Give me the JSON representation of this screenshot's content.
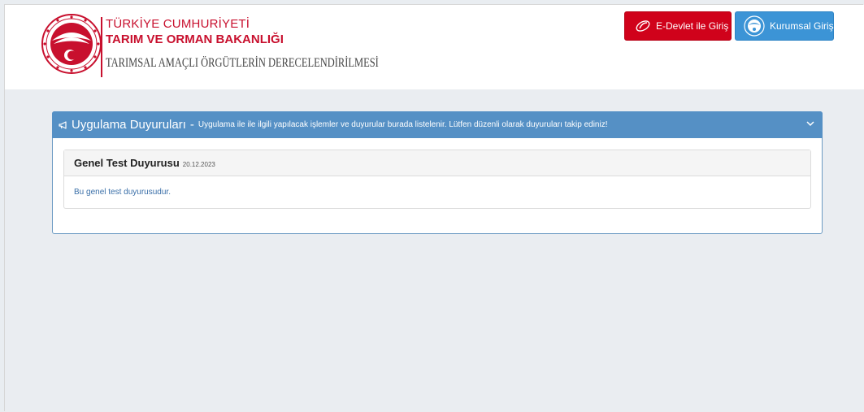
{
  "header": {
    "org_line1": "TÜRKİYE CUMHURİYETİ",
    "org_line2": "TARIM VE ORMAN BAKANLIĞI",
    "app_title": "TARIMSAL AMAÇLI ÖRGÜTLERİN DERECELENDİRİLMESİ",
    "logo_icon": "ministry-emblem-icon"
  },
  "login": {
    "edevlet_label": "E-Devlet ile Giriş",
    "kurumsal_label": "Kurumsal Giriş"
  },
  "announcements": {
    "title": "Uygulama Duyuruları",
    "separator": "-",
    "subtitle": "Uygulama ile ile ilgili yapılacak işlemler ve duyurular burada listelenir. Lütfen düzenli olarak duyuruları takip ediniz!",
    "items": [
      {
        "title": "Genel Test Duyurusu",
        "date": "20.12.2023",
        "body": "Bu genel test duyurusudur."
      }
    ]
  },
  "colors": {
    "brand_red": "#c8102e",
    "edevlet_red": "#d0021b",
    "kurumsal_blue": "#3c94d6",
    "panel_blue": "#5590c5",
    "page_bg": "#eaedf1"
  }
}
